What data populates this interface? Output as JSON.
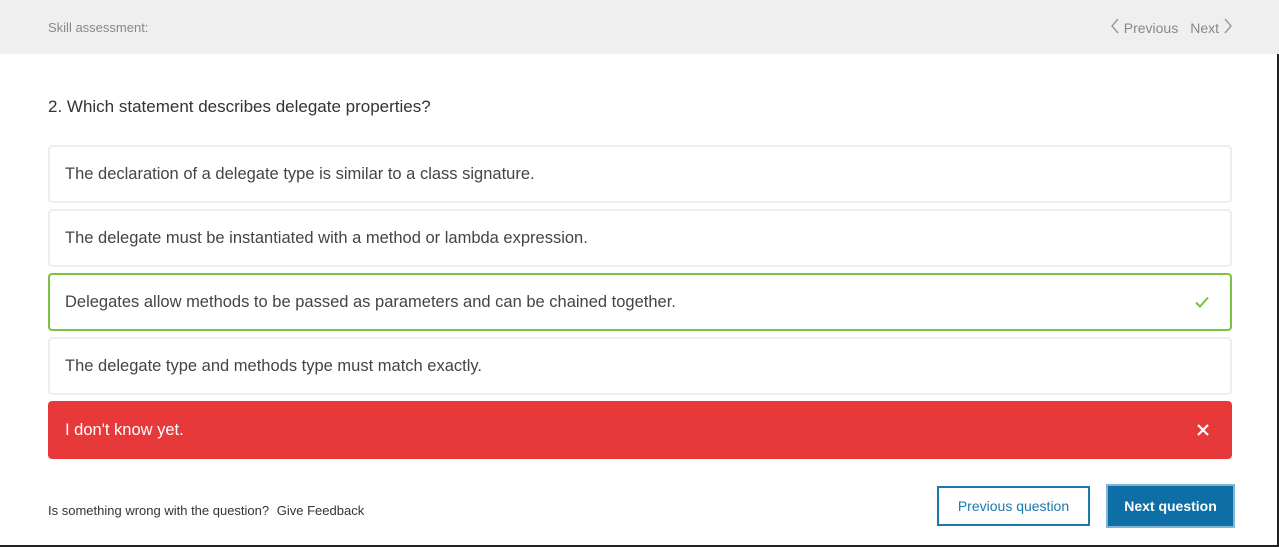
{
  "header": {
    "title": "Skill assessment:",
    "previous_label": "Previous",
    "next_label": "Next"
  },
  "question": {
    "text": "2. Which statement describes delegate properties?"
  },
  "answers": [
    {
      "text": "The declaration of a delegate type is similar to a class signature.",
      "state": "default"
    },
    {
      "text": "The delegate must be instantiated with a method or lambda expression.",
      "state": "default"
    },
    {
      "text": "Delegates allow methods to be passed as parameters and can be chained together.",
      "state": "correct",
      "icon": "check-icon"
    },
    {
      "text": "The delegate type and methods type must match exactly.",
      "state": "default"
    },
    {
      "text": "I don't know yet.",
      "state": "selected-wrong",
      "icon": "close-icon"
    }
  ],
  "footer": {
    "feedback_prompt": "Is something wrong with the question?",
    "feedback_link": "Give Feedback",
    "previous_question_label": "Previous question",
    "next_question_label": "Next question"
  },
  "colors": {
    "correct_border": "#7bc142",
    "wrong_background": "#e8393a",
    "primary_button": "#0d6fa6"
  }
}
